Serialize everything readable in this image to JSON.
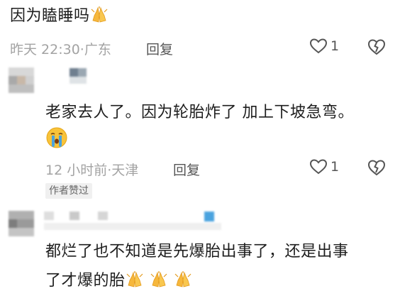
{
  "comments": [
    {
      "text": "因为瞌睡吗",
      "emoji_suffix": [
        "pray-emoji"
      ],
      "time": "昨天 22:30",
      "location": "广东",
      "reply_label": "回复",
      "like_count": "1"
    },
    {
      "text": "老家去人了。因为轮胎炸了 加上下坡急弯。",
      "emoji_line": [
        "crying-emoji"
      ],
      "time": "12 小时前",
      "location": "天津",
      "reply_label": "回复",
      "like_count": "1",
      "badge": "作者赞过"
    },
    {
      "text_line1": "都烂了也不知道是先爆胎出事了，还是出事",
      "text_line2": "了才爆的胎",
      "emoji_suffix": [
        "pray-emoji",
        "pray-emoji",
        "pray-emoji"
      ]
    }
  ],
  "meta_separator": "·",
  "colors": {
    "text": "#1d1d1d",
    "meta": "#a3a3a3",
    "icon": "#555555",
    "badge_bg": "#f0f0f0",
    "accent_blue": "#4aa3df"
  }
}
